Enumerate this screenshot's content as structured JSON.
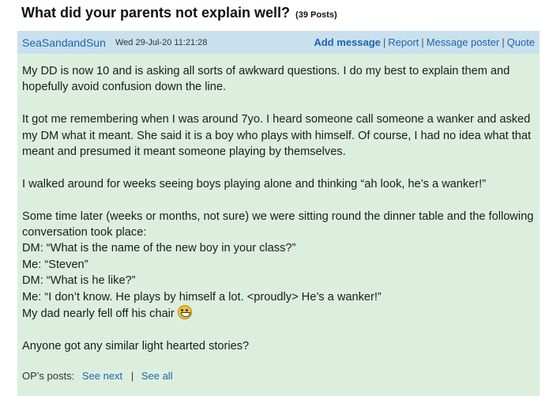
{
  "thread": {
    "title": "What did your parents not explain well?",
    "post_count": "(39 Posts)"
  },
  "post": {
    "author": "SeaSandandSun",
    "date": "Wed 29-Jul-20 11:21:28",
    "actions": {
      "add_message": "Add message",
      "report": "Report",
      "message_poster": "Message poster",
      "quote": "Quote"
    },
    "paragraphs": [
      "My DD is now 10 and is asking all sorts of awkward questions. I do my best to explain them and hopefully avoid confusion down the line.",
      "It got me remembering when I was around 7yo. I heard someone call someone a wanker and asked my DM what it meant. She said it is a boy who plays with himself. Of course, I had no idea what that meant and presumed it meant someone playing by themselves.",
      "I walked around for weeks seeing boys playing alone and thinking “ah look, he’s a wanker!”"
    ],
    "story_lines": [
      "Some time later (weeks or months, not sure) we were sitting round the dinner table and the following conversation took place:",
      "DM: “What is the name of the new boy in your class?”",
      "Me: “Steven”",
      "DM: “What is he like?”",
      "Me: “I don’t know. He plays by himself a lot. <proudly> He’s a wanker!”",
      "My dad nearly fell off his chair"
    ],
    "closing": "Anyone got any similar light hearted stories?",
    "emoji_icon": "grin-emoji-icon",
    "op_posts": {
      "label": "OP’s posts:",
      "see_next": "See next",
      "see_all": "See all"
    }
  }
}
